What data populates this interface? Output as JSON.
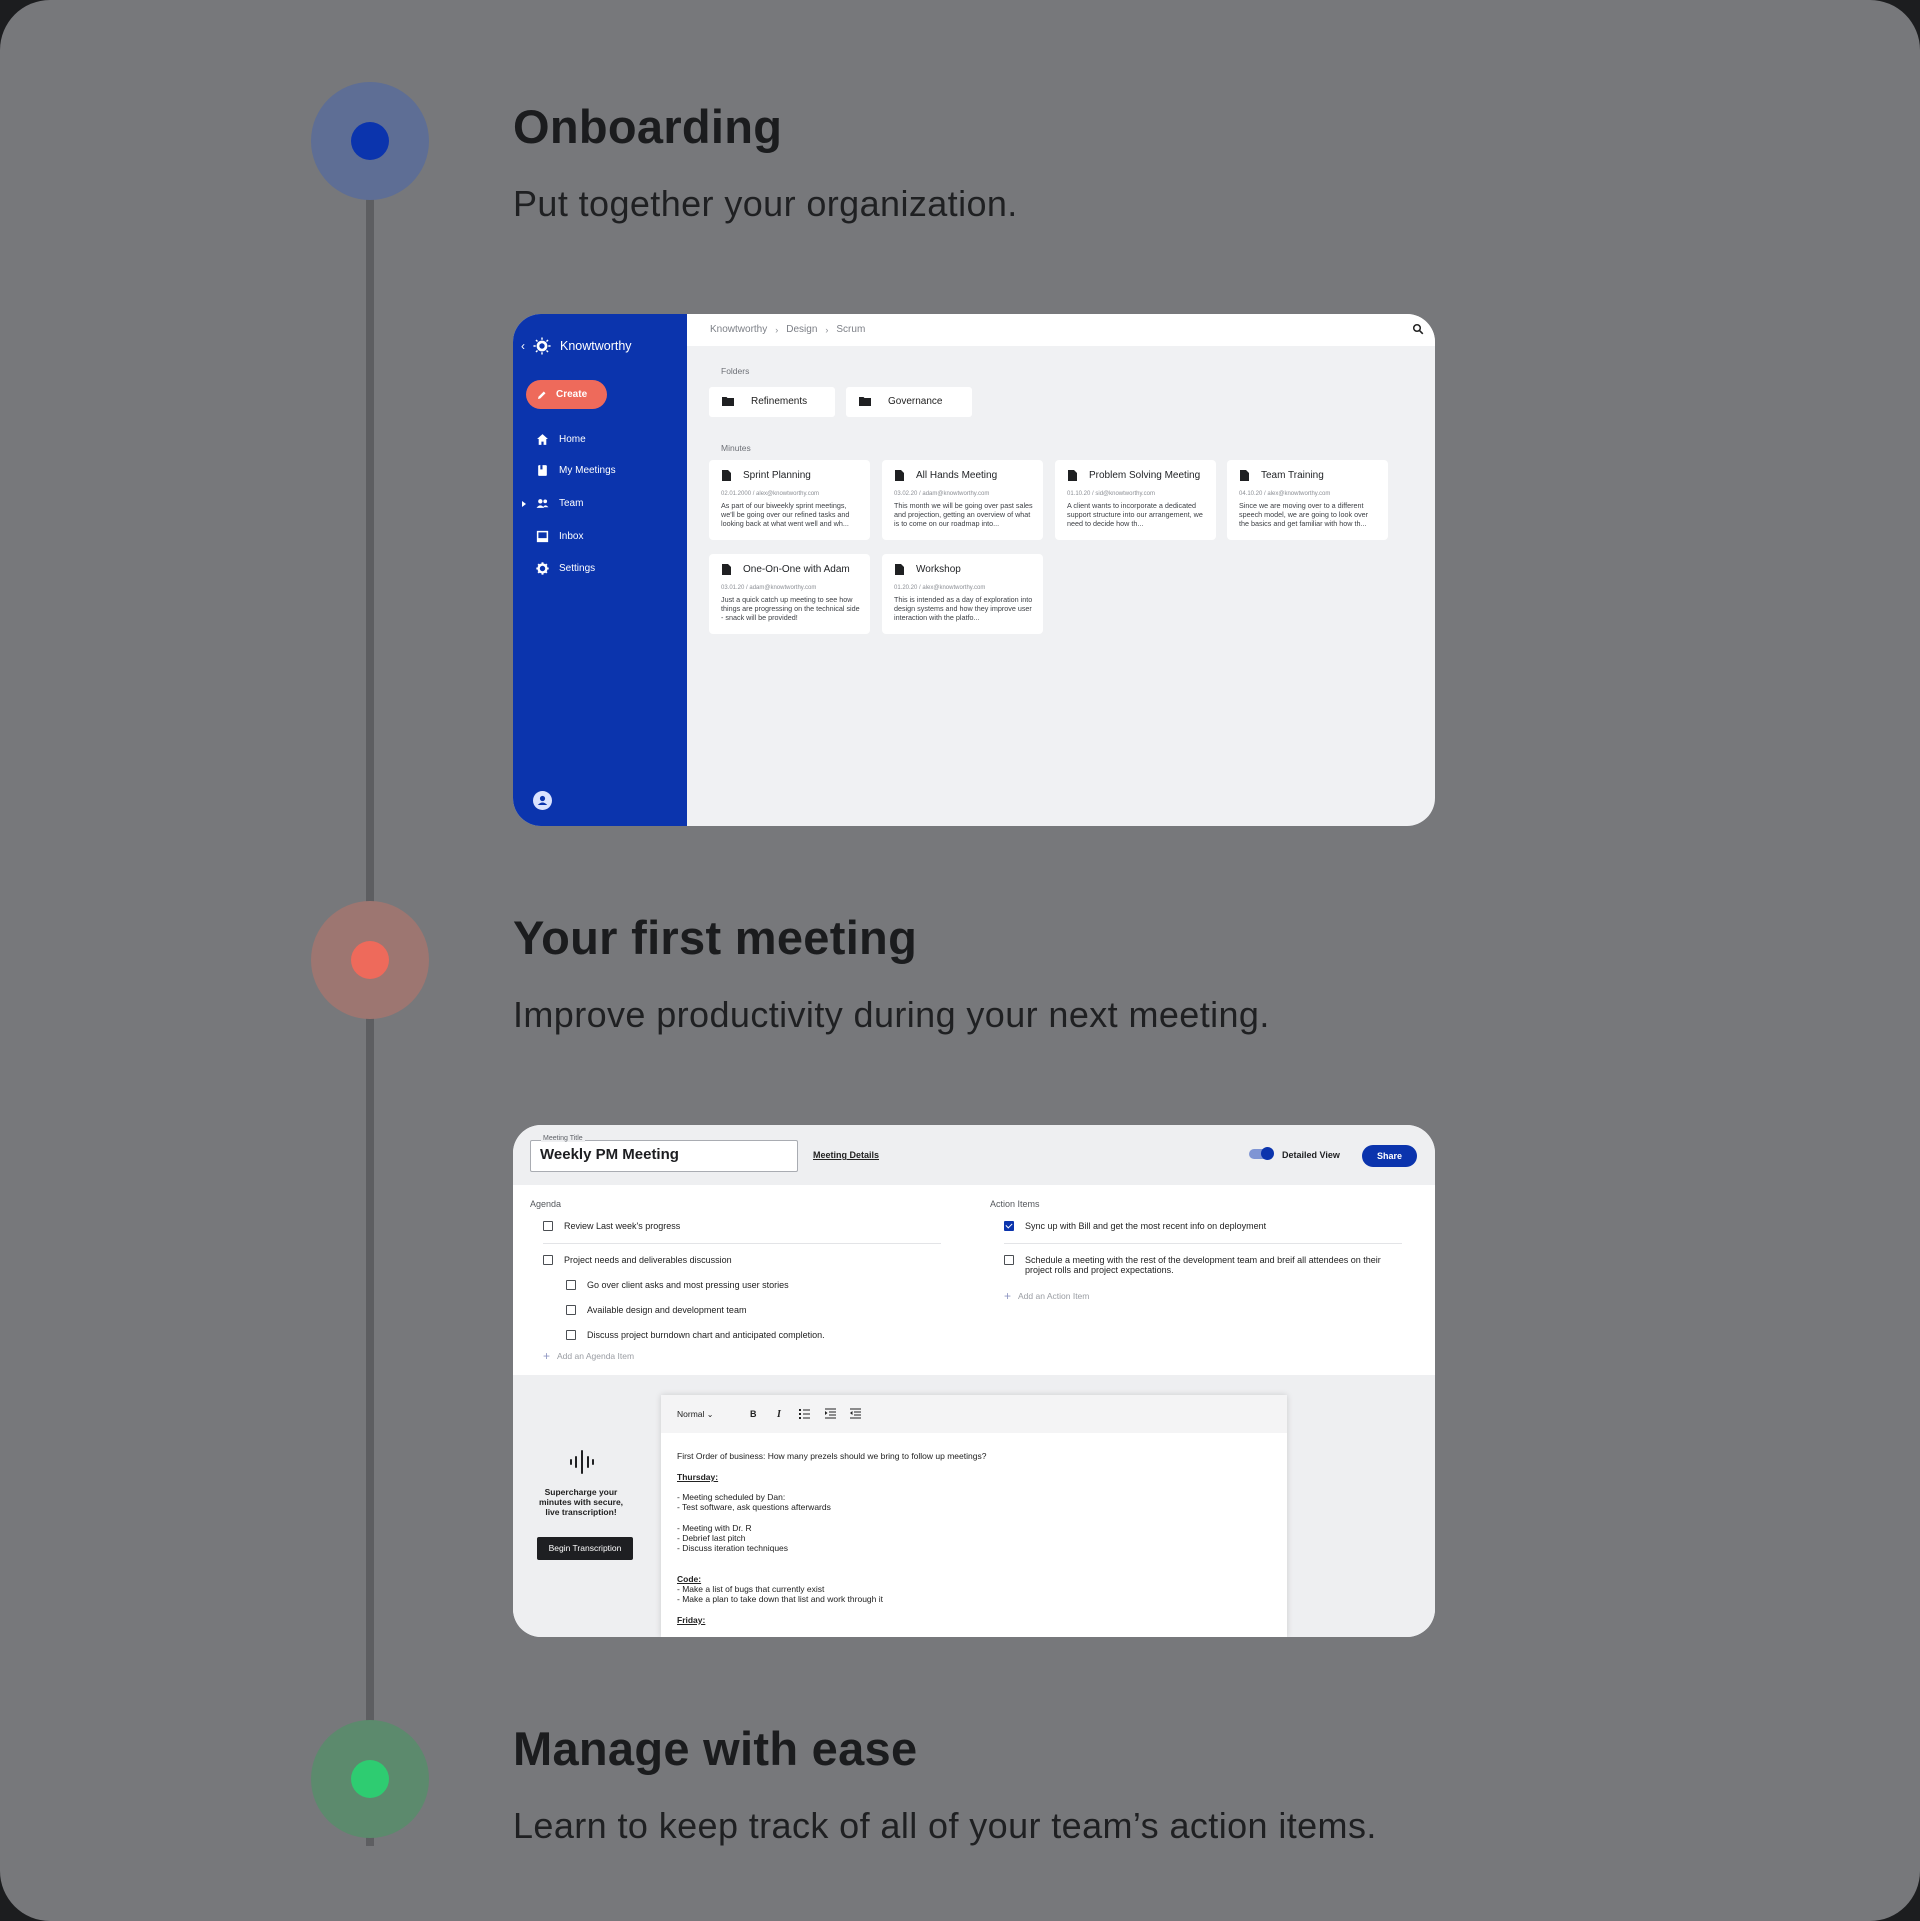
{
  "steps": [
    {
      "title": "Onboarding",
      "subtitle": "Put together your organization.",
      "color": "#0b34ad"
    },
    {
      "title": "Your first meeting",
      "subtitle": "Improve productivity during your next meeting.",
      "color": "#ee6a5b"
    },
    {
      "title": "Manage with ease",
      "subtitle": "Learn to keep track of all of your team’s action items.",
      "color": "#2ecc71"
    }
  ],
  "app1": {
    "brand": "Knowtworthy",
    "back_icon": "chevron-left-icon",
    "create_label": "Create",
    "nav": [
      {
        "label": "Home",
        "icon": "home-icon"
      },
      {
        "label": "My Meetings",
        "icon": "book-icon"
      },
      {
        "label": "Team",
        "icon": "people-icon"
      },
      {
        "label": "Inbox",
        "icon": "inbox-icon"
      },
      {
        "label": "Settings",
        "icon": "gear-icon"
      }
    ],
    "breadcrumb": [
      "Knowtworthy",
      "Design",
      "Scrum"
    ],
    "folders_label": "Folders",
    "folders": [
      "Refinements",
      "Governance"
    ],
    "minutes_label": "Minutes",
    "minutes": [
      {
        "title": "Sprint Planning",
        "meta": "02.01.2000 / alex@knowtworthy.com",
        "desc": "As part of our biweekly sprint meetings, we'll be going over our refined tasks and looking back at what went well and wh..."
      },
      {
        "title": "All Hands Meeting",
        "meta": "03.02.20 / adam@knowtworthy.com",
        "desc": "This month we will be going over past sales and projection, getting an overview of what is to come on our roadmap into..."
      },
      {
        "title": "Problem Solving Meeting",
        "meta": "01.10.20 / sid@knowtworthy.com",
        "desc": "A client wants to incorporate a dedicated support structure into our arrangement, we need to decide how th..."
      },
      {
        "title": "Team Training",
        "meta": "04.10.20 / alex@knowtworthy.com",
        "desc": "Since we are moving over to a different speech model, we are going to look over the basics and get familiar with how th..."
      },
      {
        "title": "One-On-One with Adam",
        "meta": "03.01.20 / adam@knowtworthy.com",
        "desc": "Just a quick catch up meeting to see how things are progressing on the technical side - snack will be provided!"
      },
      {
        "title": "Workshop",
        "meta": "01.20.20 / alex@knowtworthy.com",
        "desc": "This is intended as a day of exploration into design systems and how they improve user interaction with the platfo..."
      }
    ]
  },
  "app2": {
    "meeting_title_legend": "Meeting Title",
    "meeting_title": "Weekly PM Meeting",
    "details_link": "Meeting Details",
    "detailed_view_label": "Detailed View",
    "share_label": "Share",
    "agenda_label": "Agenda",
    "agenda": [
      {
        "text": "Review Last week's progress",
        "checked": false
      },
      {
        "text": "Project needs and deliverables discussion",
        "checked": false
      },
      {
        "text": "Go over client asks and most pressing user stories",
        "checked": false
      },
      {
        "text": "Available design and development team",
        "checked": false
      },
      {
        "text": "Discuss project burndown chart and anticipated completion.",
        "checked": false
      }
    ],
    "add_agenda": "Add an Agenda Item",
    "actions_label": "Action Items",
    "actions": [
      {
        "text": "Sync up with Bill and get the most recent info on deployment",
        "checked": true
      },
      {
        "text": "Schedule a meeting with the rest of the development team and breif all attendees on their",
        "text2": "project rolls and project expectations.",
        "checked": false
      }
    ],
    "add_action": "Add an Action Item",
    "promo_line1": "Supercharge your",
    "promo_line2": "minutes with secure,",
    "promo_line3": "live transcription!",
    "begin_label": "Begin Transcription",
    "editor_style": "Normal",
    "editor_lines": [
      "First Order of business: How many prezels should we bring to follow up meetings?",
      "Thursday:",
      "- Meeting scheduled by Dan:",
      "- Test software, ask questions afterwards",
      "- Meeting with Dr. R",
      "- Debrief last pitch",
      "- Discuss iteration techniques",
      "Code:",
      "- Make a list of bugs that currently exist",
      "- Make a plan to take down that list and work through it",
      "Friday:"
    ]
  }
}
